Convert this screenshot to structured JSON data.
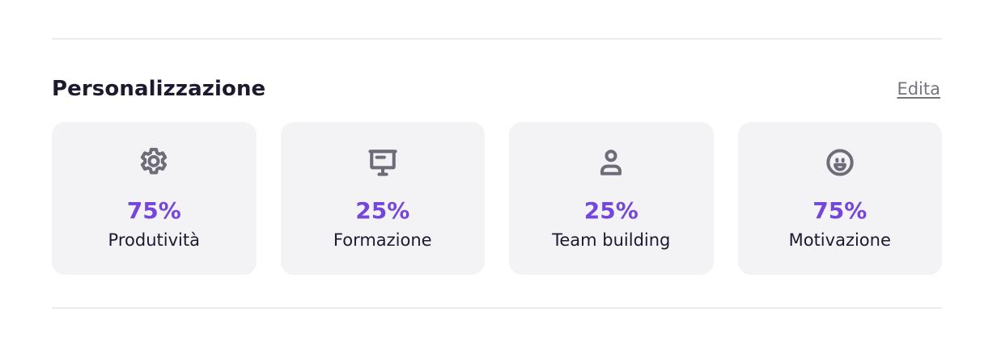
{
  "section": {
    "title": "Personalizzazione",
    "edit_label": "Edita"
  },
  "cards": [
    {
      "icon": "gear-icon",
      "value": "75%",
      "label": "Produtività"
    },
    {
      "icon": "presentation-board-icon",
      "value": "25%",
      "label": "Formazione"
    },
    {
      "icon": "person-icon",
      "value": "25%",
      "label": "Team building"
    },
    {
      "icon": "smiley-face-icon",
      "value": "75%",
      "label": "Motivazione"
    }
  ],
  "colors": {
    "accent": "#7446d9",
    "card_background": "#f3f3f6",
    "icon": "#6d6c78",
    "divider": "#ebebee"
  }
}
